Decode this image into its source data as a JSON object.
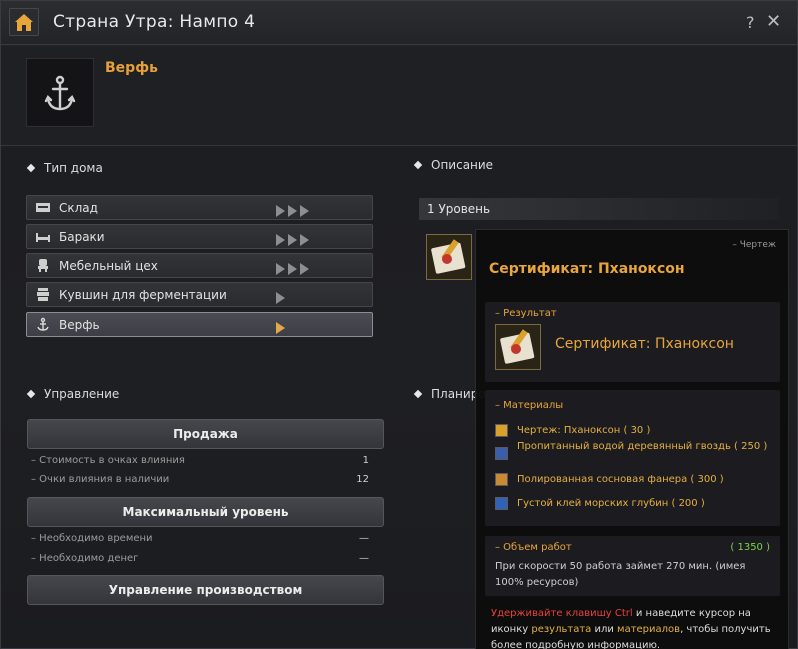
{
  "window": {
    "title": "Страна Утра: Нампо 4",
    "help_label": "?",
    "close_label": "✕"
  },
  "building": {
    "name": "Верфь",
    "icon": "anchor-icon"
  },
  "house_type": {
    "heading": "Тип дома",
    "items": [
      {
        "label": "Склад",
        "icon": "storage-icon",
        "level": 3
      },
      {
        "label": "Бараки",
        "icon": "bed-icon",
        "level": 3
      },
      {
        "label": "Мебельный цех",
        "icon": "chair-icon",
        "level": 3
      },
      {
        "label": "Кувшин для ферментации",
        "icon": "jar-icon",
        "level": 1
      },
      {
        "label": "Верфь",
        "icon": "anchor-icon",
        "level": 1,
        "active": true
      }
    ]
  },
  "management": {
    "heading": "Управление",
    "sell_button": "Продажа",
    "sell_rows": [
      {
        "label": "– Стоимость в очках влияния",
        "value": "1"
      },
      {
        "label": "– Очки влияния в наличии",
        "value": "12"
      }
    ],
    "max_level_button": "Максимальный уровень",
    "max_rows": [
      {
        "label": "– Необходимо времени",
        "value": "—"
      },
      {
        "label": "– Необходимо денег",
        "value": "—"
      }
    ],
    "production_button": "Управление производством"
  },
  "description": {
    "heading": "Описание",
    "level_label": "1 Уровень"
  },
  "planning": {
    "heading": "Планировка"
  },
  "tooltip": {
    "type": "– Чертеж",
    "title": "Сертификат: Пханоксон",
    "result_label": "– Результат",
    "result_name": "Сертификат: Пханоксон",
    "materials_label": "– Материалы",
    "materials": [
      {
        "text": "Чертеж: Пханоксон ( 30 )",
        "icon": "blueprint-icon"
      },
      {
        "text": "Пропитанный водой деревянный гвоздь ( 250 )",
        "icon": "nail-icon"
      },
      {
        "text": "Полированная сосновая фанера ( 300 )",
        "icon": "plywood-icon"
      },
      {
        "text": "Густой клей морских глубин ( 200 )",
        "icon": "glue-icon"
      }
    ],
    "work_label": "– Объем работ",
    "work_value": "( 1350 )",
    "work_desc": "При скорости 50 работа займет 270 мин. (имея 100% ресурсов)",
    "hint": {
      "p1": "Удерживайте клавишу Ctrl",
      "p2": " и наведите курсор на иконку ",
      "p3": "результата",
      "p4": " или ",
      "p5": "материалов",
      "p6": ", чтобы получить более подробную информацию."
    }
  }
}
